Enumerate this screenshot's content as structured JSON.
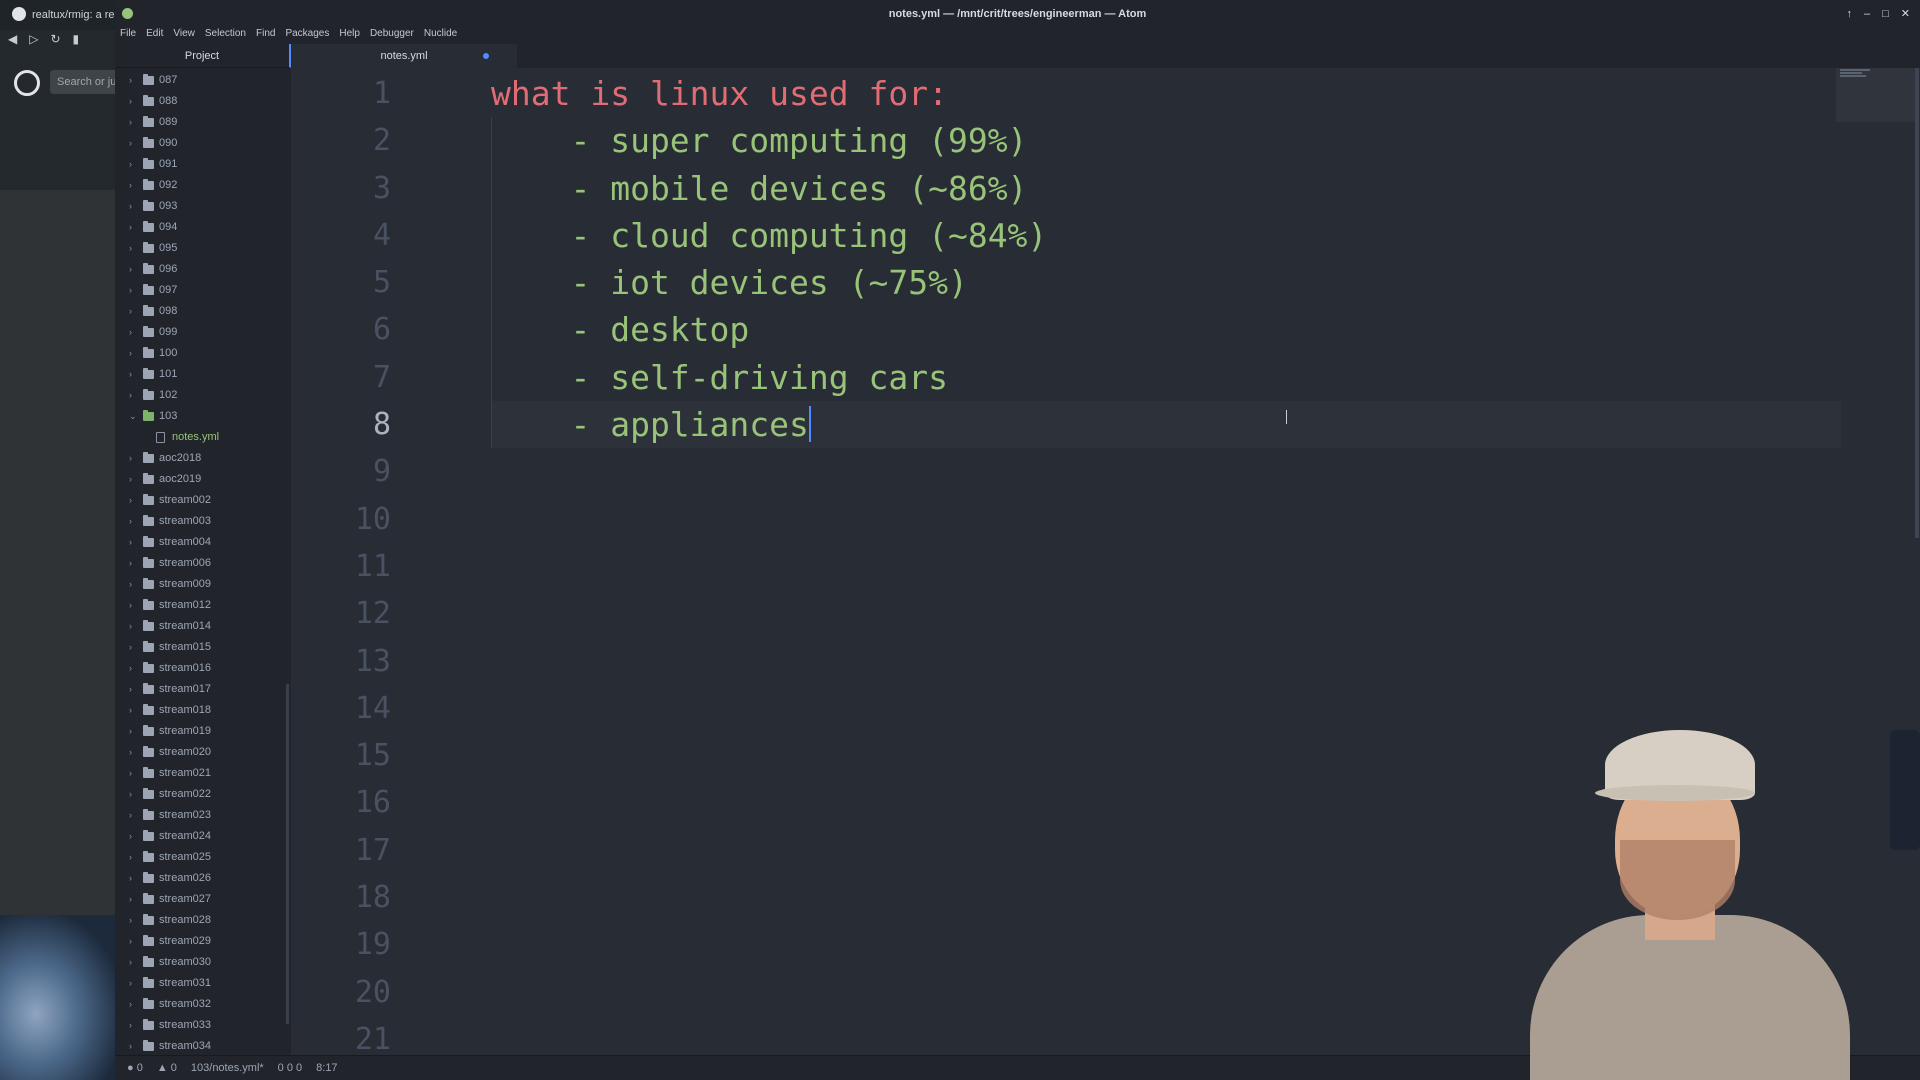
{
  "browser": {
    "tab_title": "realtux/rmig: a reim",
    "search_placeholder": "Search or ju"
  },
  "window": {
    "title": "notes.yml — /mnt/crit/trees/engineerman — Atom"
  },
  "menu": [
    "File",
    "Edit",
    "View",
    "Selection",
    "Find",
    "Packages",
    "Help",
    "Debugger",
    "Nuclide"
  ],
  "tree": {
    "header": "Project",
    "items": [
      {
        "name": "087",
        "type": "folder"
      },
      {
        "name": "088",
        "type": "folder"
      },
      {
        "name": "089",
        "type": "folder"
      },
      {
        "name": "090",
        "type": "folder"
      },
      {
        "name": "091",
        "type": "folder"
      },
      {
        "name": "092",
        "type": "folder"
      },
      {
        "name": "093",
        "type": "folder"
      },
      {
        "name": "094",
        "type": "folder"
      },
      {
        "name": "095",
        "type": "folder"
      },
      {
        "name": "096",
        "type": "folder"
      },
      {
        "name": "097",
        "type": "folder"
      },
      {
        "name": "098",
        "type": "folder"
      },
      {
        "name": "099",
        "type": "folder"
      },
      {
        "name": "100",
        "type": "folder"
      },
      {
        "name": "101",
        "type": "folder"
      },
      {
        "name": "102",
        "type": "folder"
      },
      {
        "name": "103",
        "type": "folder-open"
      },
      {
        "name": "notes.yml",
        "type": "file"
      },
      {
        "name": "aoc2018",
        "type": "folder"
      },
      {
        "name": "aoc2019",
        "type": "folder"
      },
      {
        "name": "stream002",
        "type": "folder"
      },
      {
        "name": "stream003",
        "type": "folder"
      },
      {
        "name": "stream004",
        "type": "folder"
      },
      {
        "name": "stream006",
        "type": "folder"
      },
      {
        "name": "stream009",
        "type": "folder"
      },
      {
        "name": "stream012",
        "type": "folder"
      },
      {
        "name": "stream014",
        "type": "folder"
      },
      {
        "name": "stream015",
        "type": "folder"
      },
      {
        "name": "stream016",
        "type": "folder"
      },
      {
        "name": "stream017",
        "type": "folder"
      },
      {
        "name": "stream018",
        "type": "folder"
      },
      {
        "name": "stream019",
        "type": "folder"
      },
      {
        "name": "stream020",
        "type": "folder"
      },
      {
        "name": "stream021",
        "type": "folder"
      },
      {
        "name": "stream022",
        "type": "folder"
      },
      {
        "name": "stream023",
        "type": "folder"
      },
      {
        "name": "stream024",
        "type": "folder"
      },
      {
        "name": "stream025",
        "type": "folder"
      },
      {
        "name": "stream026",
        "type": "folder"
      },
      {
        "name": "stream027",
        "type": "folder"
      },
      {
        "name": "stream028",
        "type": "folder"
      },
      {
        "name": "stream029",
        "type": "folder"
      },
      {
        "name": "stream030",
        "type": "folder"
      },
      {
        "name": "stream031",
        "type": "folder"
      },
      {
        "name": "stream032",
        "type": "folder"
      },
      {
        "name": "stream033",
        "type": "folder"
      },
      {
        "name": "stream034",
        "type": "folder"
      }
    ]
  },
  "editor": {
    "tab_label": "notes.yml",
    "modified": true,
    "line_numbers": [
      "1",
      "2",
      "3",
      "4",
      "5",
      "6",
      "7",
      "8",
      "9",
      "10",
      "11",
      "12",
      "13",
      "14",
      "15",
      "16",
      "17",
      "18",
      "19",
      "20",
      "21"
    ],
    "current_line": 8,
    "lines": [
      "what is linux used for:",
      "    - super computing (99%)",
      "    - mobile devices (~86%)",
      "    - cloud computing (~84%)",
      "    - iot devices (~75%)",
      "    - desktop",
      "    - self-driving cars",
      "    - appliances"
    ]
  },
  "status": {
    "errors": "0",
    "warnings": "0",
    "file_path": "103/notes.yml*",
    "linter": "0  0  0",
    "cursor_position": "8:17"
  },
  "colors": {
    "key": "#e06c75",
    "value": "#98c379",
    "accent": "#528bff",
    "editor_bg": "#282c34"
  }
}
